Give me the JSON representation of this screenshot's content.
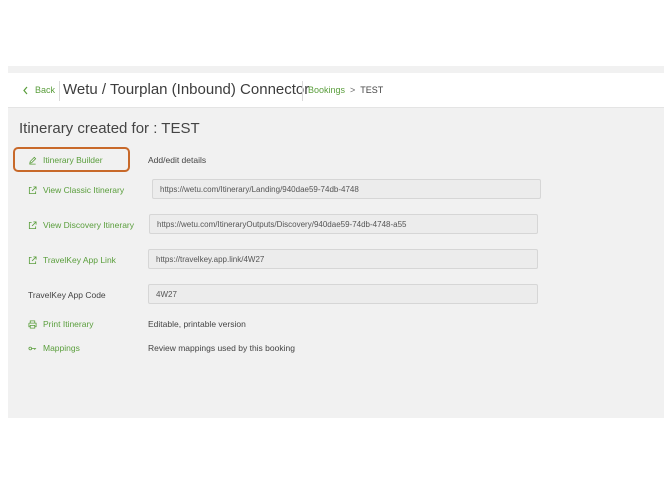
{
  "header": {
    "back_label": "Back",
    "app_title": "Wetu / Tourplan (Inbound) Connector",
    "breadcrumb_link": "Bookings",
    "breadcrumb_sep": ">",
    "breadcrumb_current": "TEST"
  },
  "page": {
    "title": "Itinerary created for : TEST"
  },
  "rows": {
    "builder": {
      "label": "Itinerary Builder",
      "desc": "Add/edit details",
      "icon": "edit-icon"
    },
    "classic": {
      "label": "View Classic Itinerary",
      "value": "https://wetu.com/Itinerary/Landing/940dae59-74db-4748",
      "icon": "external-link-icon"
    },
    "discovery": {
      "label": "View Discovery Itinerary",
      "value": "https://wetu.com/ItineraryOutputs/Discovery/940dae59-74db-4748-a55",
      "icon": "external-link-icon"
    },
    "travelkey_link": {
      "label": "TravelKey App Link",
      "value": "https://travelkey.app.link/4W27",
      "icon": "external-link-icon"
    },
    "travelkey_code": {
      "label": "TravelKey App Code",
      "value": "4W27"
    },
    "print": {
      "label": "Print Itinerary",
      "desc": "Editable, printable version",
      "icon": "print-icon"
    },
    "mappings": {
      "label": "Mappings",
      "desc": "Review mappings used by this booking",
      "icon": "key-icon"
    }
  },
  "colors": {
    "accent": "#5a9e3c",
    "highlight": "#c8692a"
  }
}
